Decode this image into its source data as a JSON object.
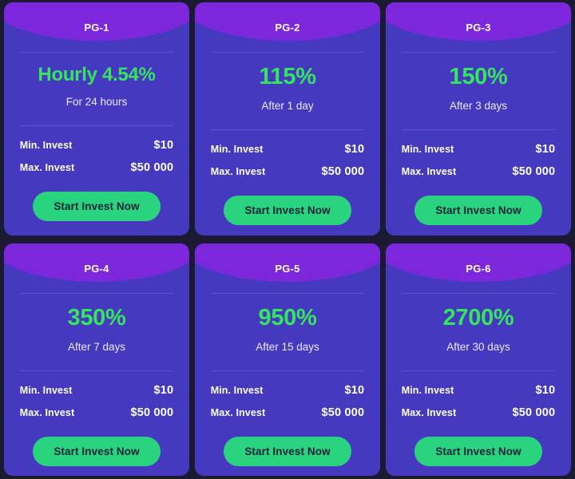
{
  "theme": {
    "page_background": "#1b1a32",
    "card_background": "#4539c0",
    "arc_purple": "#7d27dd",
    "accent_green": "#35e55e",
    "button_green": "#2ad47e",
    "button_text": "#11223b",
    "text_white": "#ffffff"
  },
  "labels": {
    "min_invest": "Min. Invest",
    "max_invest": "Max. Invest",
    "cta": "Start Invest Now"
  },
  "plans": [
    {
      "name": "PG-1",
      "rate": "Hourly 4.54%",
      "rate_size": "small",
      "term": "For 24 hours",
      "min_invest": "$10",
      "max_invest": "$50 000",
      "cta": "Start Invest Now"
    },
    {
      "name": "PG-2",
      "rate": "115%",
      "rate_size": "large",
      "term": "After 1 day",
      "min_invest": "$10",
      "max_invest": "$50 000",
      "cta": "Start Invest Now"
    },
    {
      "name": "PG-3",
      "rate": "150%",
      "rate_size": "large",
      "term": "After 3 days",
      "min_invest": "$10",
      "max_invest": "$50 000",
      "cta": "Start Invest Now"
    },
    {
      "name": "PG-4",
      "rate": "350%",
      "rate_size": "large",
      "term": "After 7 days",
      "min_invest": "$10",
      "max_invest": "$50 000",
      "cta": "Start Invest Now"
    },
    {
      "name": "PG-5",
      "rate": "950%",
      "rate_size": "large",
      "term": "After 15 days",
      "min_invest": "$10",
      "max_invest": "$50 000",
      "cta": "Start Invest Now"
    },
    {
      "name": "PG-6",
      "rate": "2700%",
      "rate_size": "large",
      "term": "After 30 days",
      "min_invest": "$10",
      "max_invest": "$50 000",
      "cta": "Start Invest Now"
    }
  ]
}
